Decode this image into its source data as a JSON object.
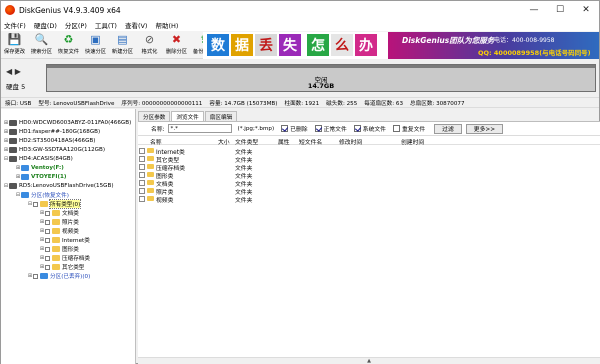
{
  "app": {
    "title": "DiskGenius V4.9.3.409 x64"
  },
  "window_controls": {
    "minimize": "—",
    "maximize": "☐",
    "close": "✕"
  },
  "menu": [
    "文件(F)",
    "硬盘(D)",
    "分区(P)",
    "工具(T)",
    "查看(V)",
    "帮助(H)"
  ],
  "toolbar": [
    {
      "label": "保存更改",
      "icon": "save-icon",
      "glyph": "💾"
    },
    {
      "label": "搜索分区",
      "icon": "search-icon",
      "glyph": "🔍"
    },
    {
      "label": "恢复文件",
      "icon": "recover-icon",
      "glyph": "♻"
    },
    {
      "label": "快速分区",
      "icon": "quick-partition-icon",
      "glyph": "▣"
    },
    {
      "label": "新建分区",
      "icon": "new-partition-icon",
      "glyph": "▤"
    },
    {
      "label": "格式化",
      "icon": "format-icon",
      "glyph": "⊘"
    },
    {
      "label": "删除分区",
      "icon": "delete-partition-icon",
      "glyph": "✖"
    },
    {
      "label": "备份分区",
      "icon": "backup-icon",
      "glyph": "⇪"
    }
  ],
  "banner": {
    "chars": [
      "数",
      "据",
      "丢",
      "失",
      "怎",
      "么",
      "办"
    ],
    "logo": "DiskGenius团队为您服务",
    "phone": "电话：400-008-9958",
    "qq": "QQ: 4000089958(与电话号码同号)"
  },
  "disk": {
    "label": "硬盘 5",
    "partition_title": "空闲",
    "partition_size": "14.7GB"
  },
  "info": [
    "接口: USB",
    "型号: LenovoUSBFlashDrive",
    "序列号: 00000000000000111",
    "容量: 14.7GB (15073MB)",
    "柱面数: 1921",
    "磁头数: 255",
    "每道扇区数: 63",
    "总扇区数: 30870077"
  ],
  "tree": [
    {
      "text": "HD0:WDCWD6003ABYZ-011FA0(466GB)"
    },
    {
      "text": "HD1:fasper##-180G(168GB)"
    },
    {
      "text": "HD2:ST3500418AS(466GB)"
    },
    {
      "text": "HD3:GW-SSDTAA120G(112GB)"
    },
    {
      "text": "HD4:ACASIS(84GB)"
    },
    {
      "text": "Ventoy(F:)"
    },
    {
      "text": "VTOYEFI(1)"
    },
    {
      "text": "RD5:LenovoUSBFlashDrive(15GB)"
    },
    {
      "text": "分区(恢复文件)"
    },
    {
      "text": "所有类型(0)"
    },
    {
      "text": "文档类"
    },
    {
      "text": "照片类"
    },
    {
      "text": "视频类"
    },
    {
      "text": "Internet类"
    },
    {
      "text": "图形类"
    },
    {
      "text": "压缩存档类"
    },
    {
      "text": "其它类型"
    },
    {
      "text": "分区(已丢弃)(0)"
    }
  ],
  "tabs": [
    "分区参数",
    "浏览文件",
    "扇区编辑"
  ],
  "filter": {
    "name_label": "名称:",
    "name_value": "*.*",
    "hint": "(*.jpg;*.bmp)",
    "checks": [
      {
        "label": "已删除",
        "checked": true
      },
      {
        "label": "正常文件",
        "checked": true
      },
      {
        "label": "系统文件",
        "checked": true
      },
      {
        "label": "重复文件",
        "checked": false
      }
    ],
    "filter_btn": "过滤",
    "more_btn": "更多>>"
  },
  "file_columns": [
    "名称",
    "大小",
    "文件类型",
    "属性",
    "短文件名",
    "修改时间",
    "创建时间"
  ],
  "files": [
    {
      "name": "Internet类",
      "type": "文件夹"
    },
    {
      "name": "其它类型",
      "type": "文件夹"
    },
    {
      "name": "压缩存档类",
      "type": "文件夹"
    },
    {
      "name": "图形类",
      "type": "文件夹"
    },
    {
      "name": "文档类",
      "type": "文件夹"
    },
    {
      "name": "照片类",
      "type": "文件夹"
    },
    {
      "name": "视频类",
      "type": "文件夹"
    }
  ],
  "scroll": {
    "glyph": "▲"
  }
}
